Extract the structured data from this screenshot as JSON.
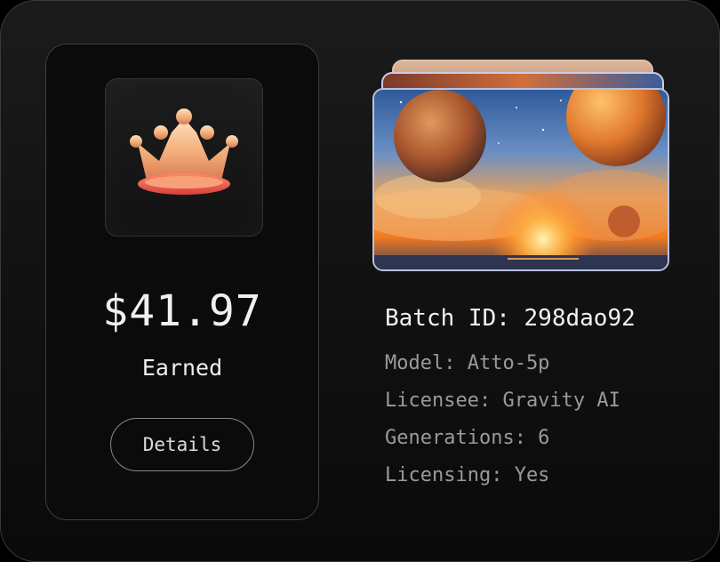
{
  "earnings": {
    "amount": "$41.97",
    "label": "Earned",
    "details_label": "Details",
    "badge_icon": "crown-icon"
  },
  "batch": {
    "id_line": "Batch ID: 298dao92",
    "model": "Model: Atto-5p",
    "licensee": "Licensee: Gravity AI",
    "generations": "Generations: 6",
    "licensing": "Licensing: Yes"
  },
  "colors": {
    "background": "#0a0a0a",
    "panel_border": "#3e3e3e",
    "text_primary": "#f0f0f0",
    "text_secondary": "#9a9a9a",
    "crown_gold": "#f0b27a",
    "crown_rose": "#e0554a"
  }
}
